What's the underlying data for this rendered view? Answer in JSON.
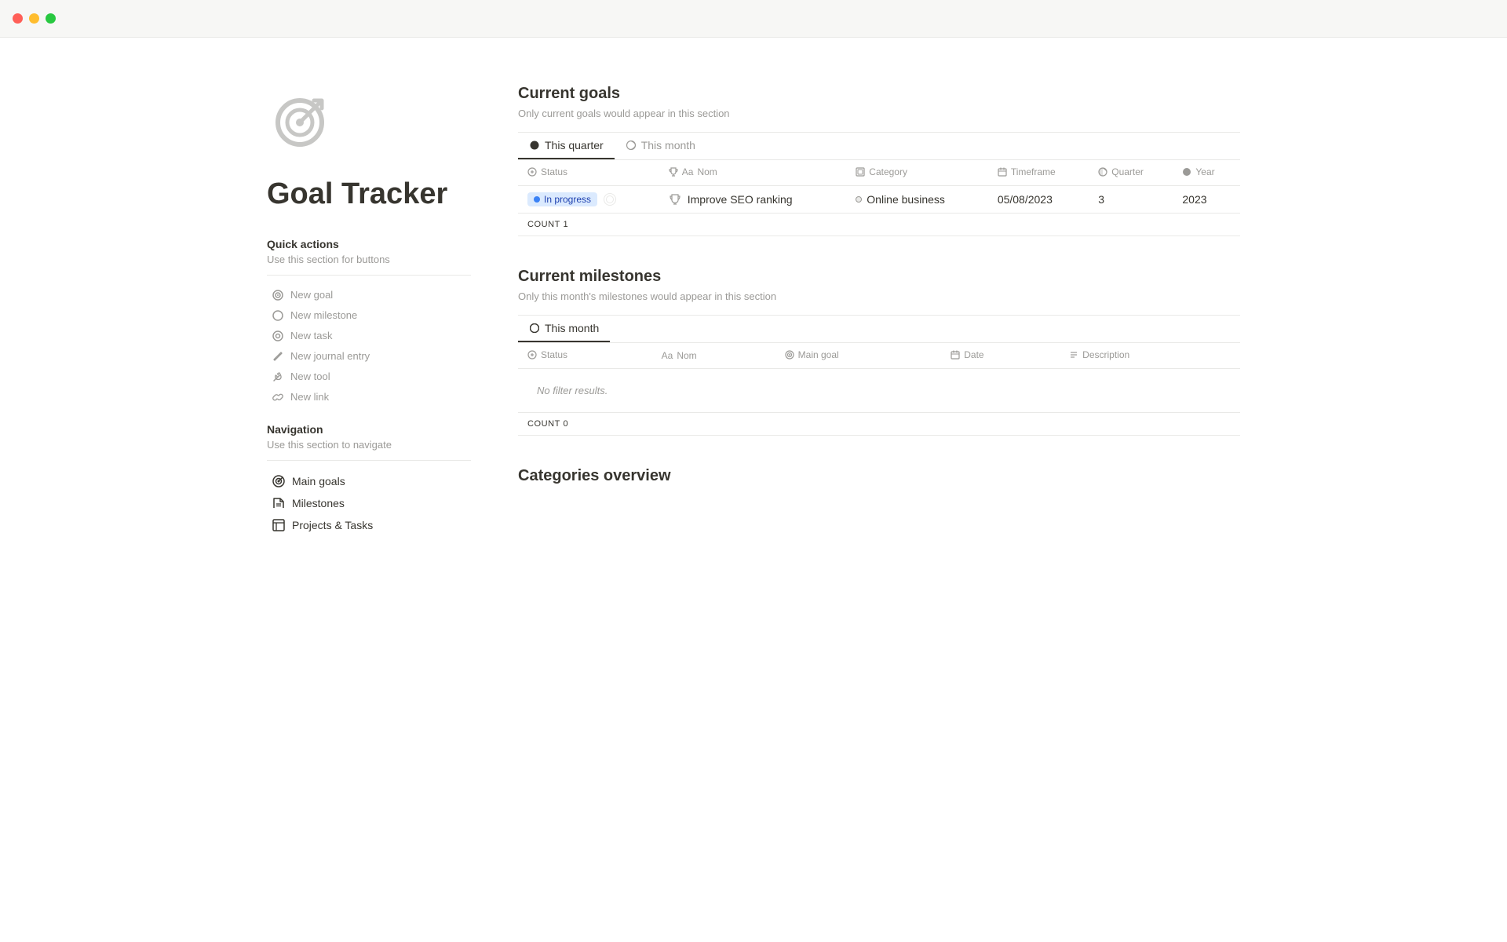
{
  "titlebar": {
    "dots": [
      "red",
      "yellow",
      "green"
    ]
  },
  "page": {
    "icon_label": "goal-tracker-icon",
    "title": "Goal Tracker"
  },
  "quick_actions": {
    "heading": "Quick actions",
    "subtext": "Use this section for buttons",
    "items": [
      {
        "id": "new-goal",
        "label": "New goal",
        "icon": "⊙"
      },
      {
        "id": "new-milestone",
        "label": "New milestone",
        "icon": "○"
      },
      {
        "id": "new-task",
        "label": "New task",
        "icon": "⊙"
      },
      {
        "id": "new-journal-entry",
        "label": "New journal entry",
        "icon": "✏"
      },
      {
        "id": "new-tool",
        "label": "New tool",
        "icon": "🔧"
      },
      {
        "id": "new-link",
        "label": "New link",
        "icon": "🔗"
      }
    ]
  },
  "navigation": {
    "heading": "Navigation",
    "subtext": "Use this section to navigate",
    "items": [
      {
        "id": "main-goals",
        "label": "Main goals",
        "icon": "⊙"
      },
      {
        "id": "milestones",
        "label": "Milestones",
        "icon": "⛳"
      },
      {
        "id": "projects-tasks",
        "label": "Projects & Tasks",
        "icon": "▢"
      }
    ]
  },
  "current_goals": {
    "title": "Current goals",
    "description": "Only current goals would appear in this section",
    "tabs": [
      {
        "id": "this-quarter",
        "label": "This quarter",
        "icon": "●",
        "active": true
      },
      {
        "id": "this-month",
        "label": "This month",
        "icon": "○",
        "active": false
      }
    ],
    "columns": [
      {
        "id": "status",
        "label": "Status",
        "icon": "✦"
      },
      {
        "id": "nom",
        "label": "Nom",
        "prefix": "Aa",
        "icon": "🏆"
      },
      {
        "id": "category",
        "label": "Category",
        "icon": "▣"
      },
      {
        "id": "timeframe",
        "label": "Timeframe",
        "icon": "📅"
      },
      {
        "id": "quarter",
        "label": "Quarter",
        "icon": "◑"
      },
      {
        "id": "year",
        "label": "Year",
        "icon": "●"
      }
    ],
    "rows": [
      {
        "status": "In progress",
        "status_type": "in-progress",
        "nom": "Improve SEO ranking",
        "category": "Online business",
        "timeframe": "05/08/2023",
        "quarter": "3",
        "year": "2023"
      }
    ],
    "count_label": "COUNT",
    "count_value": "1"
  },
  "current_milestones": {
    "title": "Current milestones",
    "description": "Only this month's milestones would appear in this section",
    "tabs": [
      {
        "id": "this-month",
        "label": "This month",
        "icon": "○",
        "active": true
      }
    ],
    "columns": [
      {
        "id": "status",
        "label": "Status",
        "icon": "✦"
      },
      {
        "id": "nom",
        "label": "Nom",
        "prefix": "Aa"
      },
      {
        "id": "main-goal",
        "label": "Main goal",
        "icon": "⊙"
      },
      {
        "id": "date",
        "label": "Date",
        "icon": "📅"
      },
      {
        "id": "description",
        "label": "Description",
        "icon": "≡"
      }
    ],
    "rows": [],
    "no_results": "No filter results.",
    "count_label": "COUNT",
    "count_value": "0"
  },
  "categories_overview": {
    "title": "Categories overview"
  }
}
